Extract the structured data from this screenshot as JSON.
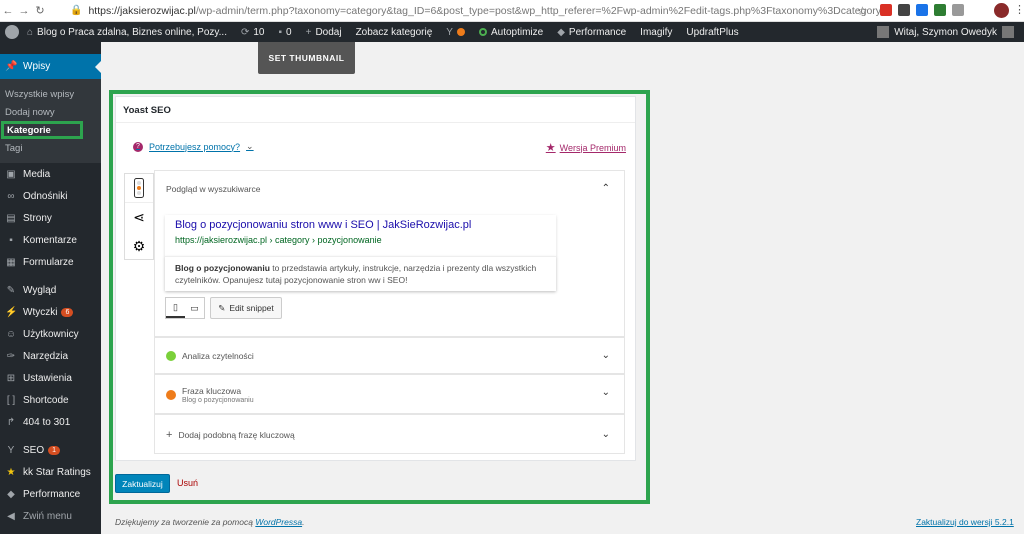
{
  "browser": {
    "url_main": "https://jaksierozwijac.pl",
    "url_rest": "/wp-admin/term.php?taxonomy=category&tag_ID=6&post_type=post&wp_http_referer=%2Fwp-admin%2Fedit-tags.php%3Ftaxonomy%3Dcategory"
  },
  "admin_bar": {
    "site_name": "Blog o Praca zdalna, Biznes online, Pozy...",
    "updates": "10",
    "comments": "0",
    "add_new": "Dodaj",
    "view_category": "Zobacz kategorię",
    "autoptimize": "Autoptimize",
    "performance": "Performance",
    "imagify": "Imagify",
    "updraft": "UpdraftPlus",
    "greeting": "Witaj, Szymon Owedyk"
  },
  "sidebar": {
    "wpisy": "Wpisy",
    "sub": [
      "Wszystkie wpisy",
      "Dodaj nowy",
      "Kategorie",
      "Tagi"
    ],
    "items": [
      {
        "label": "Media",
        "icon": "media-icon"
      },
      {
        "label": "Odnośniki",
        "icon": "link-icon"
      },
      {
        "label": "Strony",
        "icon": "pages-icon"
      },
      {
        "label": "Komentarze",
        "icon": "comments-icon"
      },
      {
        "label": "Formularze",
        "icon": "forms-icon"
      }
    ],
    "items2": [
      {
        "label": "Wygląd",
        "icon": "appearance-icon"
      },
      {
        "label": "Wtyczki",
        "icon": "plugins-icon",
        "badge": "6"
      },
      {
        "label": "Użytkownicy",
        "icon": "users-icon"
      },
      {
        "label": "Narzędzia",
        "icon": "tools-icon"
      },
      {
        "label": "Ustawienia",
        "icon": "settings-icon"
      },
      {
        "label": "Shortcode",
        "icon": "shortcode-icon"
      },
      {
        "label": "404 to 301",
        "icon": "redirect-icon"
      }
    ],
    "items3": [
      {
        "label": "SEO",
        "icon": "yoast-icon",
        "badge": "1"
      },
      {
        "label": "kk Star Ratings",
        "icon": "star-icon"
      },
      {
        "label": "Performance",
        "icon": "performance-icon"
      },
      {
        "label": "Zwiń menu",
        "icon": "collapse-icon"
      }
    ]
  },
  "content": {
    "set_thumbnail": "SET THUMBNAIL",
    "yoast_title": "Yoast SEO",
    "help_link": "Potrzebujesz pomocy?",
    "premium_link": "Wersja Premium",
    "preview_heading": "Podgląd w wyszukiwarce",
    "snippet_title": "Blog o pozycjonowaniu stron www i SEO | JakSieRozwijac.pl",
    "snippet_url": "https://jaksierozwijac.pl › category › pozycjonowanie",
    "snippet_desc_bold": "Blog o pozycjonowaniu",
    "snippet_desc_rest": " to przedstawia artykuły, instrukcje, narzędzia i prezenty dla wszystkich czytelników. Opanujesz tutaj pozycjonowanie stron ww i SEO!",
    "edit_snippet": "Edit snippet",
    "readability": "Analiza czytelności",
    "keyphrase": "Fraza kluczowa",
    "keyphrase_value": "Blog o pozycjonowaniu",
    "add_keyphrase": "Dodaj podobną frazę kluczową",
    "update_button": "Zaktualizuj",
    "delete_link": "Usuń"
  },
  "footer": {
    "thanks": "Dziękujemy za tworzenie za pomocą",
    "wp_link": "WordPressa",
    "update_version": "Zaktualizuj do wersji 5.2.1"
  }
}
